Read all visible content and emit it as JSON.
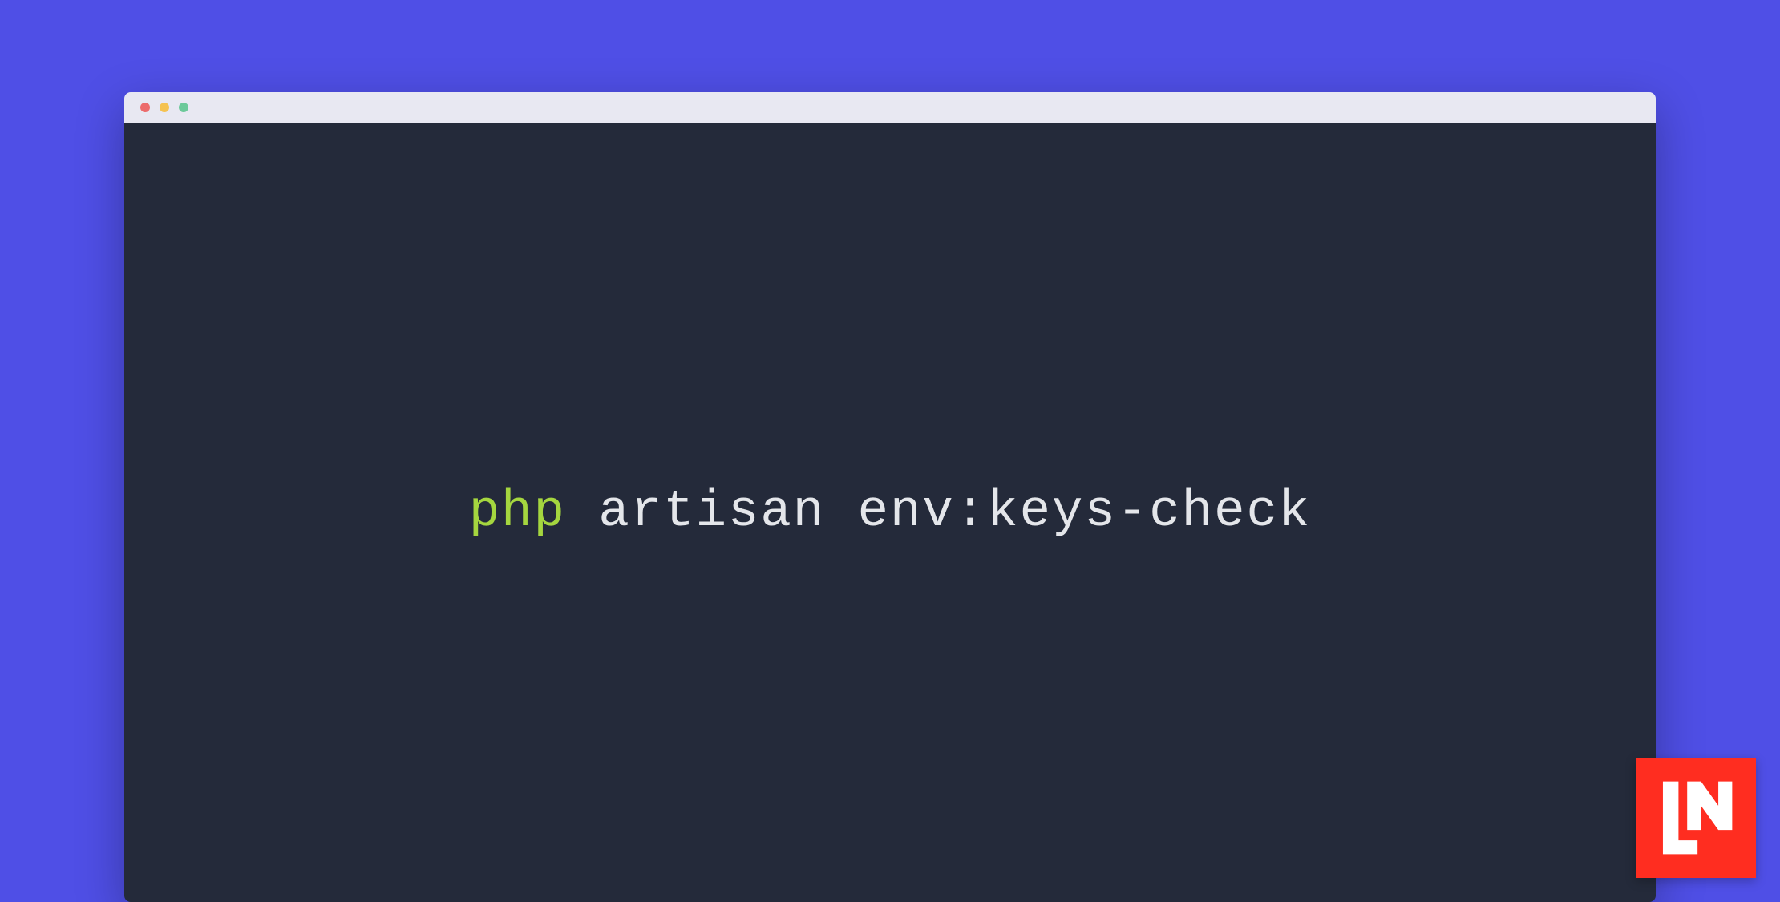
{
  "colors": {
    "background": "#4f4fe6",
    "titlebar": "#e8e8f2",
    "terminal_bg": "#242a3a",
    "dot_red": "#ec6b6c",
    "dot_yellow": "#f5c251",
    "dot_green": "#6cc99a",
    "cmd_highlight": "#a5d63f",
    "cmd_text": "#e4e6ea",
    "logo_bg": "#ff2d20"
  },
  "terminal": {
    "command_highlight": "php",
    "command_rest": " artisan env:keys-check"
  },
  "logo": {
    "name": "laravel-news-logo",
    "letters": "LN"
  }
}
